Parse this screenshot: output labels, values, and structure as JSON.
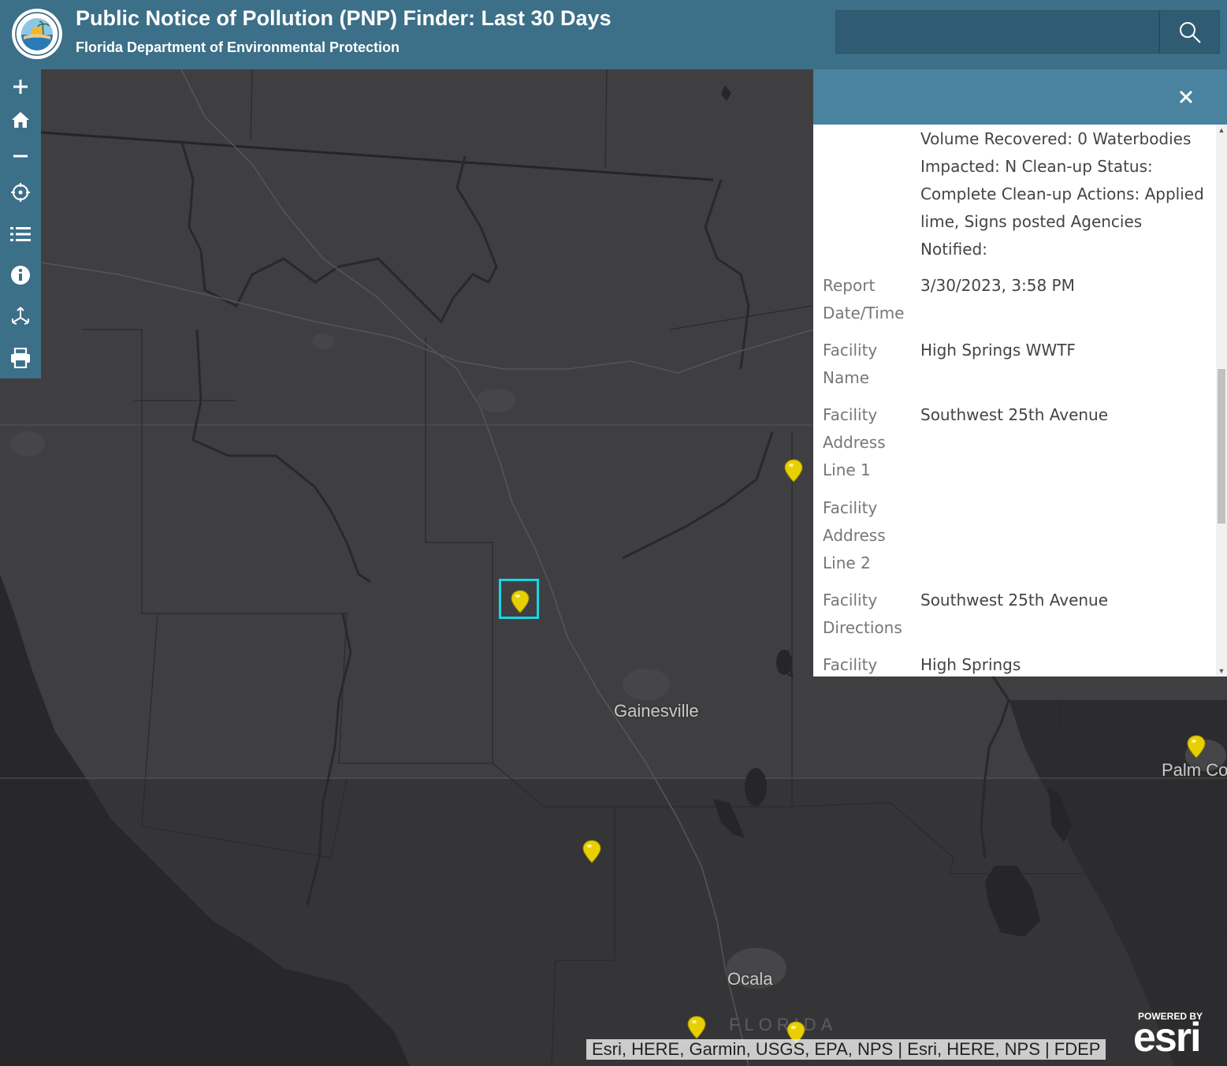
{
  "header": {
    "title": "Public Notice of Pollution (PNP) Finder: Last 30 Days",
    "subtitle": "Florida Department of Environmental Protection",
    "search_placeholder": ""
  },
  "toolbar": {
    "items": [
      "zoom-in",
      "home",
      "zoom-out",
      "locate",
      "layer-list",
      "info",
      "share",
      "print"
    ]
  },
  "map": {
    "places": [
      "Gainesville",
      "Ocala",
      "Palm Co"
    ],
    "state_label": "FLORIDA",
    "marker_color": "#e8d000",
    "selection_color": "#19d5e8"
  },
  "popup": {
    "description": "Volume Recovered: 0 Waterbodies Impacted: N Clean-up Status: Complete Clean-up Actions: Applied lime, Signs posted Agencies Notified:",
    "rows": [
      {
        "label": "Report Date/Time",
        "value": "3/30/2023, 3:58 PM"
      },
      {
        "label": "Facility Name",
        "value": "High Springs WWTF"
      },
      {
        "label": "Facility Address Line 1",
        "value": "Southwest 25th Avenue"
      },
      {
        "label": "Facility Address Line 2",
        "value": ""
      },
      {
        "label": "Facility Directions",
        "value": "Southwest 25th Avenue"
      },
      {
        "label": "Facility",
        "value": "High Springs"
      }
    ]
  },
  "attribution": "Esri, HERE, Garmin, USGS, EPA, NPS | Esri, HERE, NPS | FDEP",
  "esri_logo": {
    "powered_by": "POWERED BY",
    "word": "esri"
  }
}
